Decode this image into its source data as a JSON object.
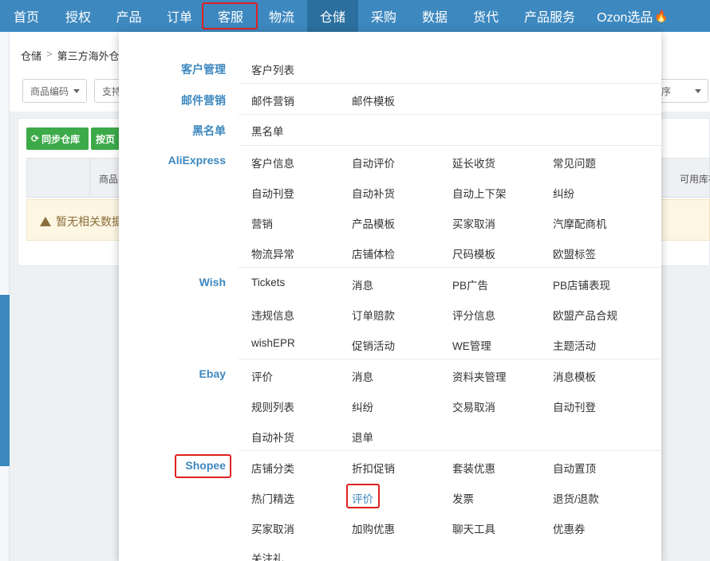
{
  "nav": {
    "items": [
      "首页",
      "授权",
      "产品",
      "订单",
      "客服",
      "物流",
      "仓储",
      "采购",
      "数据",
      "货代",
      "产品服务",
      "Ozon选品"
    ],
    "fire_icon": "🔥"
  },
  "breadcrumb": {
    "root": "仓储",
    "sep": ">",
    "current": "第三方海外仓"
  },
  "filters": {
    "product_code": "商品编码",
    "support": "支持",
    "sort": "序"
  },
  "buttons": {
    "sync": "同步仓库",
    "by_page": "按页"
  },
  "table": {
    "col_product": "商品",
    "col_available": "可用库存"
  },
  "empty_text": "暂无相关数据",
  "menu": {
    "categories": [
      "客户管理",
      "邮件营销",
      "黑名单",
      "AliExpress",
      "Wish",
      "Ebay",
      "Shopee"
    ],
    "customer_mgmt": [
      "客户列表"
    ],
    "email": [
      "邮件营销",
      "邮件模板"
    ],
    "blacklist": [
      "黑名单"
    ],
    "aliexpress": [
      [
        "客户信息",
        "自动评价",
        "延长收货",
        "常见问题"
      ],
      [
        "自动刊登",
        "自动补货",
        "自动上下架",
        "纠纷"
      ],
      [
        "营销",
        "产品模板",
        "买家取消",
        "汽摩配商机"
      ],
      [
        "物流异常",
        "店铺体检",
        "尺码模板",
        "欧盟标签"
      ]
    ],
    "wish": [
      [
        "Tickets",
        "消息",
        "PB广告",
        "PB店铺表现"
      ],
      [
        "违规信息",
        "订单赔款",
        "评分信息",
        "欧盟产品合规"
      ],
      [
        "wishEPR",
        "促销活动",
        "WE管理",
        "主题活动"
      ]
    ],
    "ebay": [
      [
        "评价",
        "消息",
        "资料夹管理",
        "消息模板"
      ],
      [
        "规则列表",
        "纠纷",
        "交易取消",
        "自动刊登"
      ],
      [
        "自动补货",
        "退单"
      ]
    ],
    "shopee": [
      [
        "店铺分类",
        "折扣促销",
        "套装优惠",
        "自动置顶"
      ],
      [
        "热门精选",
        "评价",
        "发票",
        "退货/退款"
      ],
      [
        "买家取消",
        "加购优惠",
        "聊天工具",
        "优惠券"
      ],
      [
        "关注礼"
      ]
    ]
  },
  "colors": {
    "nav_bg": "#3d88bf",
    "accent": "#3d88bf",
    "highlight": "#e02020"
  }
}
